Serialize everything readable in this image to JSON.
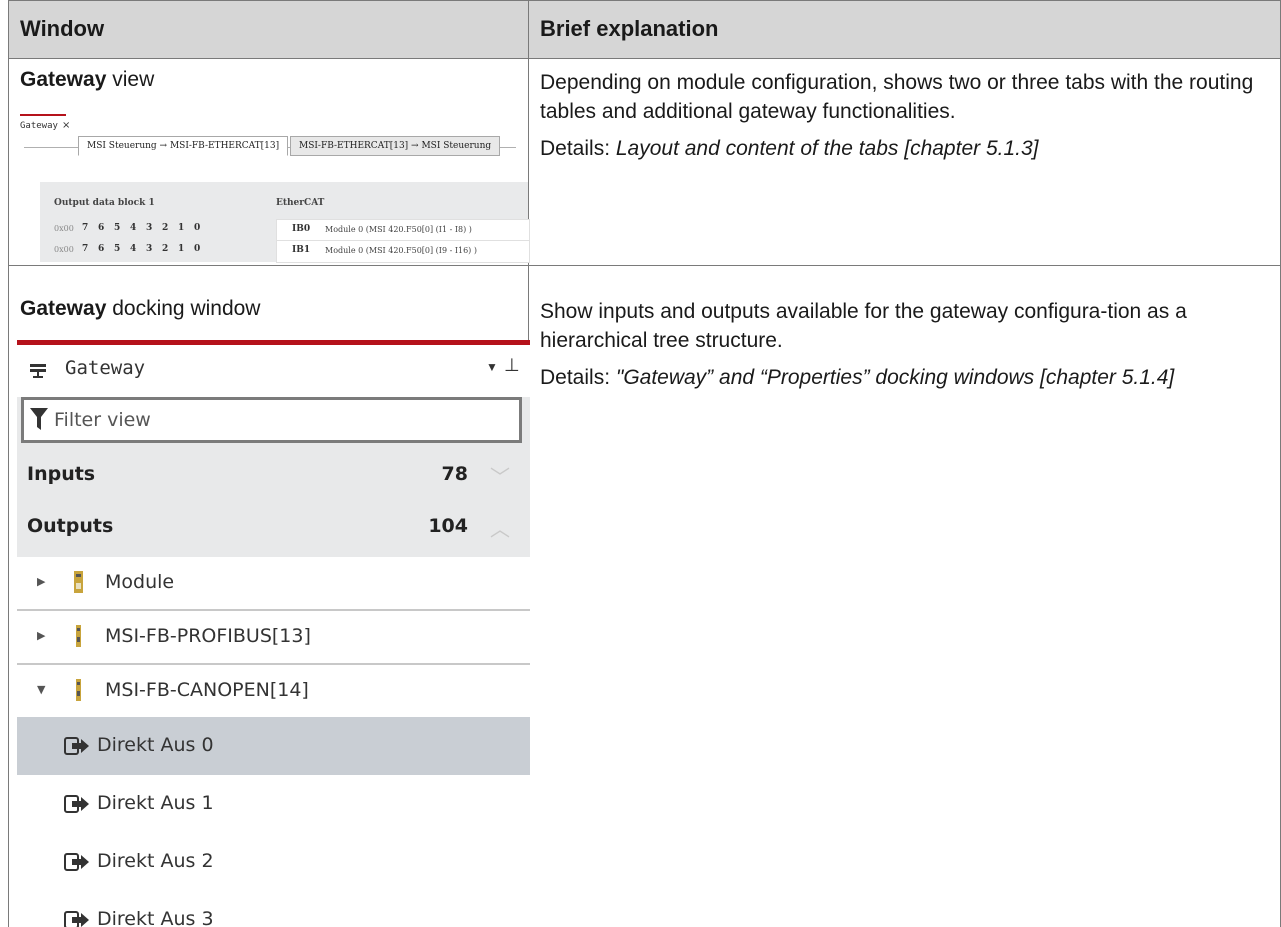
{
  "table": {
    "headers": {
      "window": "Window",
      "explanation": "Brief explanation"
    },
    "rows": [
      {
        "title_bold": "Gateway",
        "title_rest": " view",
        "desc": "Depending on module configuration, shows two or three tabs with the routing tables and additional gateway functionalities.",
        "details_label": "Details: ",
        "details_link": "Layout and content of the tabs [chapter 5.1.3]"
      },
      {
        "title_bold": "Gateway",
        "title_rest": " docking window",
        "desc": "Show inputs and outputs available for the gateway configura-tion as a hierarchical tree structure.",
        "details_label": "Details: ",
        "details_link": "\"Gateway” and “Properties” docking windows [chapter 5.1.4]"
      }
    ]
  },
  "gateway_view": {
    "doc_tab": "Gateway",
    "close_glyph": "×",
    "tabs": [
      "MSI Steuerung → MSI-FB-ETHERCAT[13]",
      "MSI-FB-ETHERCAT[13] → MSI Steuerung"
    ],
    "panel_left_header": "Output data block 1",
    "panel_right_header": "EtherCAT",
    "rows": [
      {
        "addr": "0x00",
        "bits": [
          "7",
          "6",
          "5",
          "4",
          "3",
          "2",
          "1",
          "0"
        ],
        "key": "IB0",
        "value": "Module 0 (MSI 420.F50[0] (I1 - I8) )"
      },
      {
        "addr": "0x00",
        "bits": [
          "7",
          "6",
          "5",
          "4",
          "3",
          "2",
          "1",
          "0"
        ],
        "key": "IB1",
        "value": "Module 0 (MSI 420.F50[0] (I9 - I16) )"
      }
    ]
  },
  "docking_window": {
    "title": "Gateway",
    "dropdown_glyph": "▼",
    "pin_glyph": "⊥",
    "filter_placeholder": "Filter view",
    "sections": [
      {
        "label": "Inputs",
        "count": "78",
        "chevron": "﹀"
      },
      {
        "label": "Outputs",
        "count": "104",
        "chevron": "︿"
      }
    ],
    "nodes": [
      {
        "label": "Module",
        "expanded": false,
        "arrow": "▶"
      },
      {
        "label": "MSI-FB-PROFIBUS[13]",
        "expanded": false,
        "arrow": "▶"
      },
      {
        "label": "MSI-FB-CANOPEN[14]",
        "expanded": true,
        "arrow": "▼"
      }
    ],
    "leaves": [
      {
        "label": "Direkt Aus 0",
        "selected": true
      },
      {
        "label": "Direkt Aus 1",
        "selected": false
      },
      {
        "label": "Direkt Aus 2",
        "selected": false
      },
      {
        "label": "Direkt Aus 3",
        "selected": false
      }
    ],
    "colors": {
      "accent": "#b5121b",
      "selected_bg": "#c9ced4",
      "module_icon": "#c8a43c"
    }
  }
}
